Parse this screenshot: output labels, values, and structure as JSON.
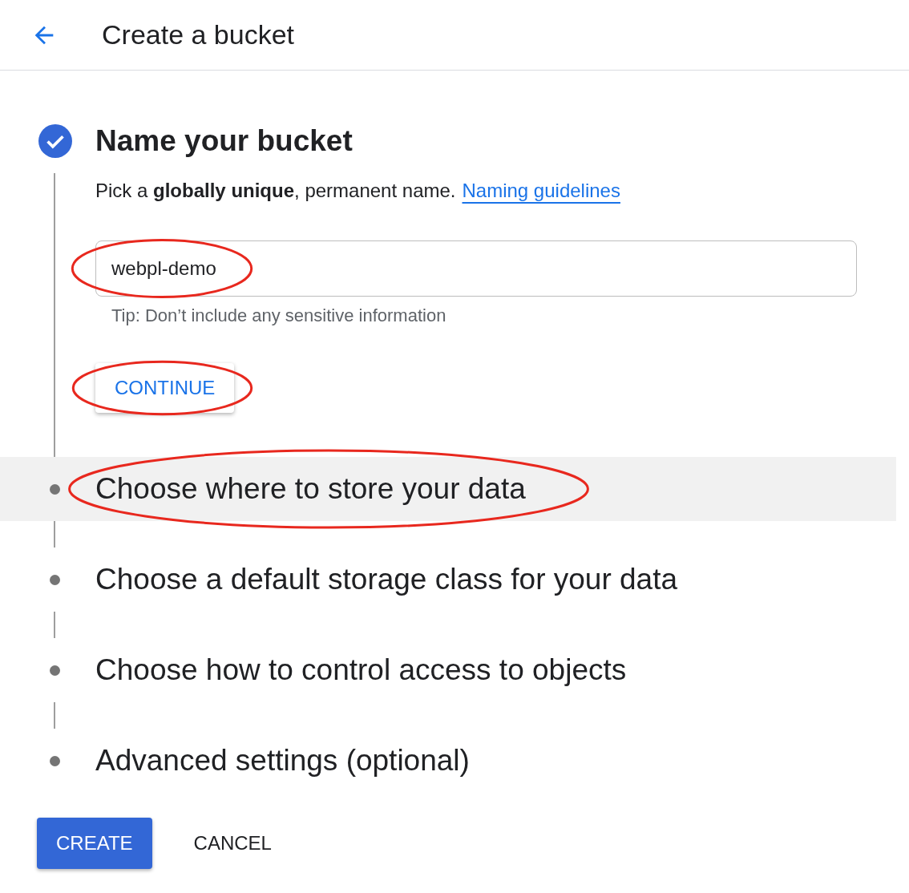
{
  "header": {
    "title": "Create a bucket"
  },
  "steps": [
    {
      "kind": "done",
      "title": "Name your bucket",
      "hovered": false,
      "circled": false,
      "expanded": true,
      "description": "Pick a **globally unique**, permanent name.",
      "link": "Naming guidelines",
      "input": {
        "value": "webpl-demo",
        "circled": true
      },
      "tip": "Tip: Don’t include any sensitive information",
      "button": {
        "label": "CONTINUE",
        "circled": true
      }
    },
    {
      "kind": "pending",
      "title": "Choose where to store your data",
      "hovered": true,
      "circled": true,
      "expanded": false
    },
    {
      "kind": "pending",
      "title": "Choose a default storage class for your data",
      "hovered": false,
      "circled": false,
      "expanded": false
    },
    {
      "kind": "pending",
      "title": "Choose how to control access to objects",
      "hovered": false,
      "circled": false,
      "expanded": false
    },
    {
      "kind": "pending",
      "title": "Advanced settings (optional)",
      "hovered": false,
      "circled": false,
      "expanded": false
    }
  ],
  "actions": [
    {
      "label": "CREATE",
      "kind": "primary"
    },
    {
      "label": "CANCEL",
      "kind": "text"
    }
  ]
}
